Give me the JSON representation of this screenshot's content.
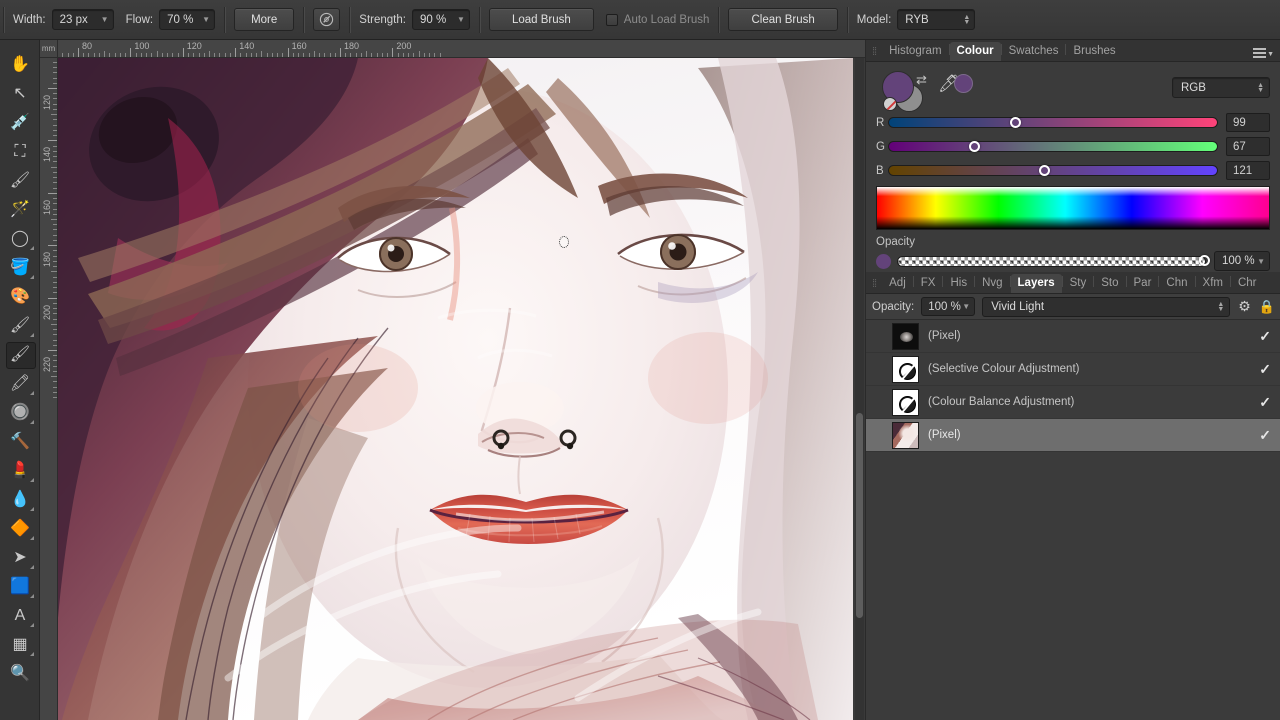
{
  "toolbar": {
    "width_label": "Width:",
    "width_value": "23 px",
    "flow_label": "Flow:",
    "flow_value": "70 %",
    "more_label": "More",
    "stabiliser_icon": "brush-target-icon",
    "strength_label": "Strength:",
    "strength_value": "90 %",
    "load_brush_label": "Load Brush",
    "auto_load_brush_label": "Auto Load Brush",
    "clean_brush_label": "Clean Brush",
    "model_label": "Model:",
    "model_value": "RYB"
  },
  "tools": [
    {
      "name": "view-pan-tool",
      "glyph": "✋",
      "selected": false,
      "corner": false
    },
    {
      "name": "move-tool",
      "glyph": "↖",
      "selected": false,
      "corner": false
    },
    {
      "name": "colour-picker-tool",
      "glyph": "💉",
      "selected": false,
      "corner": false
    },
    {
      "name": "crop-tool",
      "glyph": "⛶",
      "selected": false,
      "corner": false
    },
    {
      "name": "selection-brush-tool",
      "glyph": "🖌",
      "selected": false,
      "corner": false
    },
    {
      "name": "flood-select-tool",
      "glyph": "🪄",
      "selected": false,
      "corner": false
    },
    {
      "name": "freehand-selection-tool",
      "glyph": "◯",
      "selected": false,
      "corner": true
    },
    {
      "name": "flood-fill-tool",
      "glyph": "🪣",
      "selected": false,
      "corner": true
    },
    {
      "name": "paint-mixer-brush-tool",
      "glyph": "🎨",
      "selected": false,
      "corner": false
    },
    {
      "name": "paint-brush-tool",
      "glyph": "🖌",
      "selected": false,
      "corner": true
    },
    {
      "name": "mixer-brush-tool",
      "glyph": "🖌",
      "selected": true,
      "corner": false
    },
    {
      "name": "erase-brush-tool",
      "glyph": "🖍",
      "selected": false,
      "corner": true
    },
    {
      "name": "dodge-brush-tool",
      "glyph": "🔘",
      "selected": false,
      "corner": true
    },
    {
      "name": "clone-brush-tool",
      "glyph": "🔨",
      "selected": false,
      "corner": false
    },
    {
      "name": "smudge-brush-tool",
      "glyph": "💄",
      "selected": false,
      "corner": true
    },
    {
      "name": "blur-brush-tool",
      "glyph": "💧",
      "selected": false,
      "corner": true
    },
    {
      "name": "gradient-tool",
      "glyph": "🔶",
      "selected": false,
      "corner": true
    },
    {
      "name": "node-tool",
      "glyph": "➤",
      "selected": false,
      "corner": true
    },
    {
      "name": "rectangle-shape-tool",
      "glyph": "🟦",
      "selected": false,
      "corner": true
    },
    {
      "name": "text-tool",
      "glyph": "A",
      "selected": false,
      "corner": true
    },
    {
      "name": "mesh-warp-tool",
      "glyph": "▦",
      "selected": false,
      "corner": true
    },
    {
      "name": "zoom-tool",
      "glyph": "🔍",
      "selected": false,
      "corner": false
    }
  ],
  "rulers": {
    "unit": "mm",
    "horizontal_labels": [
      "80",
      "100",
      "120",
      "140",
      "160",
      "180",
      "200"
    ],
    "vertical_labels": [
      "120",
      "140",
      "160",
      "180",
      "200",
      "220"
    ]
  },
  "panel_tabs_top": {
    "items": [
      "Histogram",
      "Colour",
      "Swatches",
      "Brushes"
    ],
    "active": "Colour",
    "menu_icon": "hamburger-menu-icon"
  },
  "colour_panel": {
    "primary_colour": "#63437a",
    "secondary_colour": "#8f8f8f",
    "pipette_icon": "eyedropper-icon",
    "swap_icon": "swap-colours-icon",
    "model_value": "RGB",
    "channels": [
      {
        "name": "R",
        "value": "99",
        "percent": 38.8
      },
      {
        "name": "G",
        "value": "67",
        "percent": 26.3
      },
      {
        "name": "B",
        "value": "121",
        "percent": 47.5
      }
    ],
    "opacity_label": "Opacity",
    "opacity_value": "100 %",
    "opacity_percent": 100
  },
  "panel_tabs_layers": {
    "items": [
      "Adj",
      "FX",
      "His",
      "Nvg",
      "Layers",
      "Sty",
      "Sto",
      "Par",
      "Chn",
      "Xfm",
      "Chr"
    ],
    "active": "Layers"
  },
  "layers_panel": {
    "opacity_label": "Opacity:",
    "opacity_value": "100 %",
    "blend_mode": "Vivid Light",
    "settings_icon": "gear-icon",
    "lock_icon": "lock-icon",
    "rows": [
      {
        "name": "(Pixel)",
        "kind": "pixel-dark",
        "selected": false,
        "visible": true
      },
      {
        "name": "(Selective Colour Adjustment)",
        "kind": "adjustment",
        "selected": false,
        "visible": true
      },
      {
        "name": "(Colour Balance Adjustment)",
        "kind": "adjustment",
        "selected": false,
        "visible": true
      },
      {
        "name": "(Pixel)",
        "kind": "pixel-portrait",
        "selected": true,
        "visible": true
      }
    ],
    "check_glyph": "✓"
  },
  "canvas": {
    "artwork_title": "digital-portrait-painting",
    "cursor_icon": "brush-cursor"
  }
}
